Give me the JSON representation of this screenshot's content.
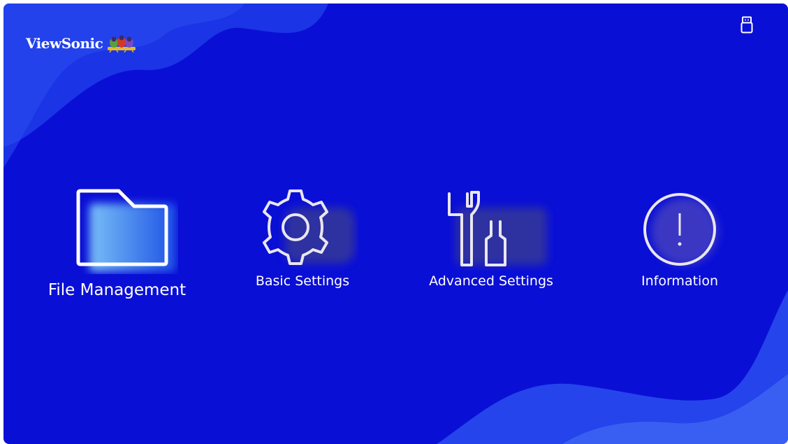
{
  "header": {
    "brand": "ViewSonic",
    "logo_icon": "viewsonic-birds-logo",
    "usb_icon": "usb-storage-icon"
  },
  "menu": {
    "items": [
      {
        "label": "File Management",
        "icon": "folder-icon",
        "selected": true
      },
      {
        "label": "Basic Settings",
        "icon": "gear-icon",
        "selected": false
      },
      {
        "label": "Advanced Settings",
        "icon": "tools-icon",
        "selected": false
      },
      {
        "label": "Information",
        "icon": "info-icon",
        "selected": false
      }
    ]
  },
  "colors": {
    "background": "#0a0fd6",
    "wave_light": "#2a4ef0",
    "wave_mid": "#1b34e6",
    "highlight": "#3aa0f5",
    "text": "#ffffff"
  }
}
